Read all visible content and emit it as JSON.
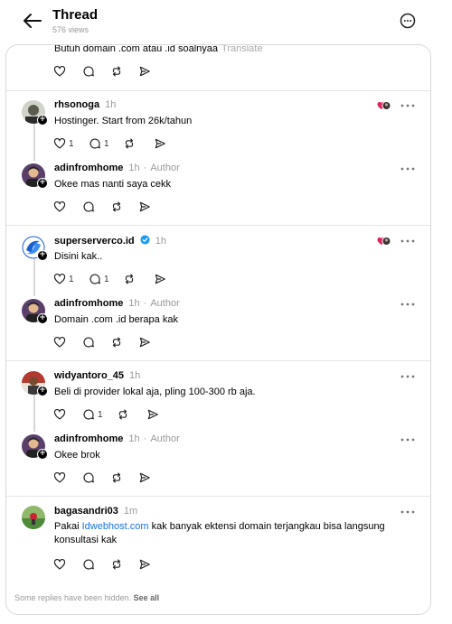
{
  "header": {
    "title": "Thread",
    "views": "576 views"
  },
  "top_post": {
    "text": "Butuh domain .com atau .id soalnyaa",
    "translate_label": "Translate"
  },
  "replies": [
    {
      "user": "rhsonoga",
      "time": "1h",
      "text": "Hostinger. Start from 26k/tahun",
      "like_count": "1",
      "reply_count": "1"
    },
    {
      "user": "adinfromhome",
      "time": "1h",
      "author_tag": "Author",
      "text": "Okee mas nanti saya cekk"
    },
    {
      "user": "superserverco.id",
      "time": "1h",
      "verified": true,
      "text": "Disini kak..",
      "like_count": "1",
      "reply_count": "1"
    },
    {
      "user": "adinfromhome",
      "time": "1h",
      "author_tag": "Author",
      "text": "Domain .com .id berapa kak"
    },
    {
      "user": "widyantoro_45",
      "time": "1h",
      "text": "Beli di provider lokal aja, pling 100-300 rb aja.",
      "reply_count": "1"
    },
    {
      "user": "adinfromhome",
      "time": "1h",
      "author_tag": "Author",
      "text": "Okee brok"
    },
    {
      "user": "bagasandri03",
      "time": "1m",
      "text_prefix": "Pakai ",
      "link": "Idwebhost.com",
      "text_suffix": " kak banyak ektensi domain terjangkau bisa langsung konsultasi kak"
    }
  ],
  "footer": {
    "text": "Some replies have been hidden.",
    "see_all": "See all"
  },
  "colors": {
    "link": "#1a73e8",
    "verified": "#1d9bf0",
    "muted": "#999999",
    "border": "#d9d9d9"
  }
}
